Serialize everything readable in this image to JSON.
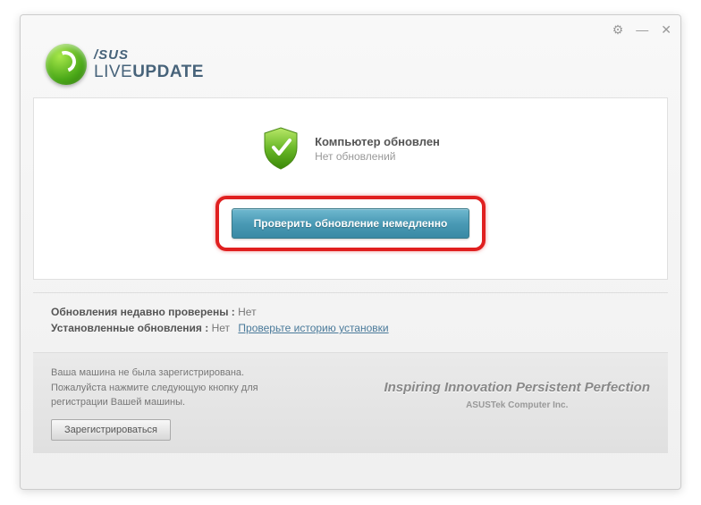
{
  "app": {
    "brand": "/SUS",
    "product_prefix": "LIVE",
    "product_bold": "UPDATE"
  },
  "status": {
    "title": "Компьютер обновлен",
    "subtitle": "Нет обновлений"
  },
  "actions": {
    "check_now": "Проверить обновление немедленно"
  },
  "info": {
    "recent_label": "Обновления недавно проверены :",
    "recent_value": "Нет",
    "installed_label": "Установленные обновления :",
    "installed_value": "Нет",
    "history_link": "Проверьте историю установки"
  },
  "footer": {
    "reg_line1": "Ваша машина не была зарегистрирована.",
    "reg_line2": "Пожалуйста нажмите следующую кнопку для",
    "reg_line3": "регистрации Вашей машины.",
    "register_btn": "Зарегистрироваться",
    "slogan": "Inspiring Innovation  Persistent Perfection",
    "company": "ASUSTek Computer Inc."
  }
}
